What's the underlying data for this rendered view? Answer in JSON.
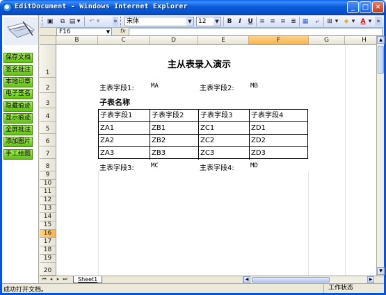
{
  "window": {
    "title": "EditDocument - Windows Internet Explorer",
    "minimize": "_",
    "maximize": "□",
    "close": "✕"
  },
  "sidebar": {
    "buttons": [
      {
        "label": "保存文档"
      },
      {
        "label": "签名批注"
      },
      {
        "label": "本地印章"
      },
      {
        "label": "电子签名"
      },
      {
        "label": "隐藏痕迹"
      },
      {
        "label": "显示痕迹"
      },
      {
        "label": "全屏批注"
      },
      {
        "label": "添加图片"
      },
      {
        "label": "手工绘图"
      }
    ]
  },
  "toolbar": {
    "font_name": "宋体",
    "font_size": "12",
    "bold": "B",
    "italic": "I",
    "underline": "U"
  },
  "formula_bar": {
    "name_box": "F16",
    "fx": "fx",
    "value": ""
  },
  "sheet": {
    "columns": [
      "B",
      "C",
      "D",
      "E",
      "F",
      "G",
      "H"
    ],
    "selected_column": "F",
    "rows": [
      "1",
      "2",
      "3",
      "4",
      "5",
      "6",
      "7",
      "8",
      "9",
      "10",
      "11",
      "12",
      "13",
      "14",
      "15",
      "16",
      "17",
      "18",
      "19",
      "20"
    ],
    "selected_row": "16",
    "title": "主从表录入演示",
    "master": {
      "f1_label": "主表字段1:",
      "f1_value": "MA",
      "f2_label": "主表字段2:",
      "f2_value": "MB",
      "f3_label": "主表字段3:",
      "f3_value": "MC",
      "f4_label": "主表字段4:",
      "f4_value": "MD"
    },
    "subtable_title": "子表名称",
    "subtable": {
      "headers": [
        "子表字段1",
        "子表字段2",
        "子表字段3",
        "子表字段4"
      ],
      "rows": [
        [
          "ZA1",
          "ZB1",
          "ZC1",
          "ZD1"
        ],
        [
          "ZA2",
          "ZB2",
          "ZC2",
          "ZD2"
        ],
        [
          "ZA3",
          "ZB3",
          "ZC3",
          "ZD3"
        ]
      ]
    },
    "tab": "Sheet1"
  },
  "status": {
    "message": "成功打开文档。",
    "state": "工作状态"
  }
}
